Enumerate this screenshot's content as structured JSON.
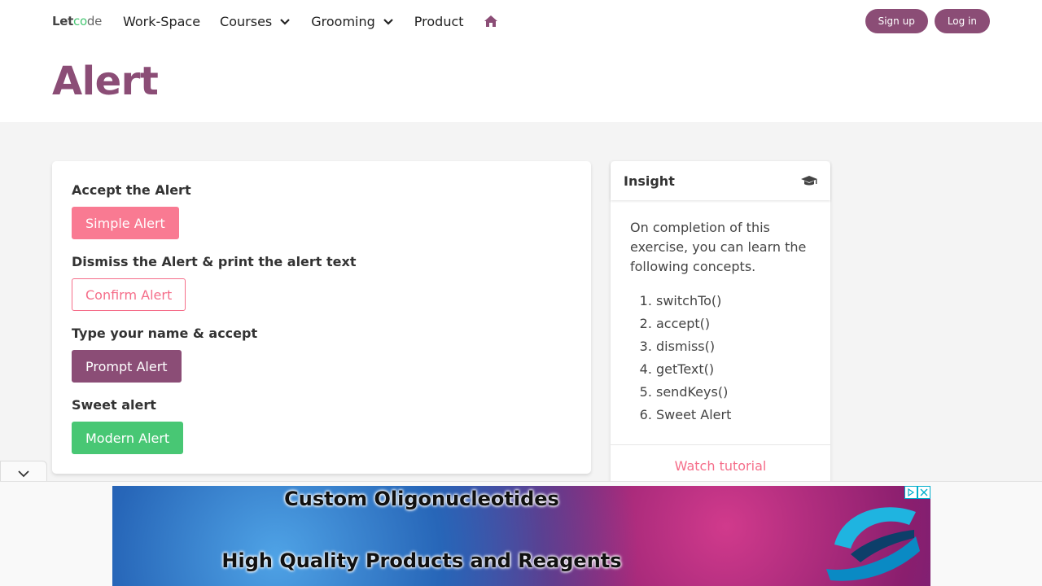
{
  "nav": {
    "logo": {
      "part1": "Let",
      "part2": "co",
      "part3": "de"
    },
    "items": [
      "Work-Space",
      "Courses",
      "Grooming",
      "Product"
    ],
    "signup": "Sign up",
    "login": "Log in"
  },
  "page": {
    "title": "Alert"
  },
  "alerts": [
    {
      "label": "Accept the Alert",
      "button": "Simple Alert"
    },
    {
      "label": "Dismiss the Alert & print the alert text",
      "button": "Confirm Alert"
    },
    {
      "label": "Type your name & accept",
      "button": "Prompt Alert"
    },
    {
      "label": "Sweet alert",
      "button": "Modern Alert"
    }
  ],
  "insight": {
    "title": "Insight",
    "description": "On completion of this exercise, you can learn the following concepts.",
    "concepts": [
      "switchTo()",
      "accept()",
      "dismiss()",
      "getText()",
      "sendKeys()",
      "Sweet Alert"
    ],
    "watch": "Watch tutorial"
  },
  "ad": {
    "line1": "Custom Oligonucleotides",
    "line2": "High Quality Products and Reagents"
  },
  "colors": {
    "brand": "#8b4d76",
    "pink": "#f56e8a",
    "green": "#48c774"
  }
}
